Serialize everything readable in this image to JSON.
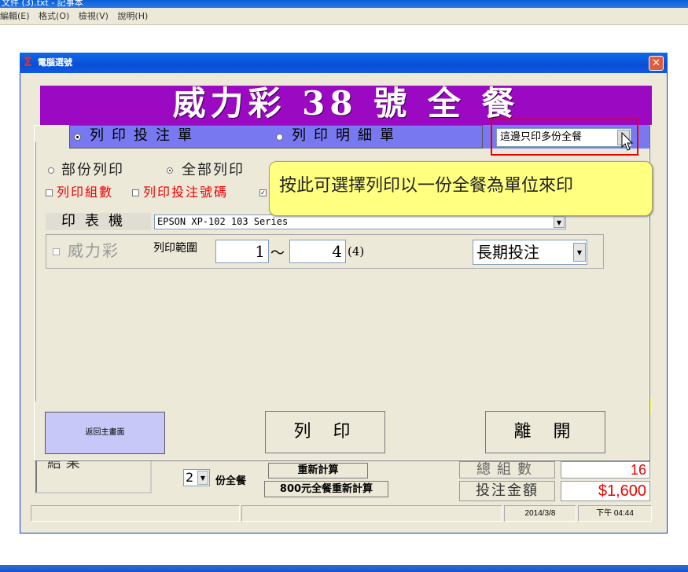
{
  "notepad": {
    "title": "文件 (3).txt - 記事本",
    "menu": [
      "編輯(E)",
      "格式(O)",
      "檢視(V)",
      "說明(H)"
    ]
  },
  "dialog": {
    "title": "電腦選號",
    "banner": "威力彩 38 號 全 餐"
  },
  "print_dialog": {
    "tab_print_ticket": "列印投注單",
    "tab_print_detail": "列印明細單",
    "mode_dropdown": "這邊只印多份全餐",
    "radio_partial": "部份列印",
    "radio_all": "全部列印",
    "chk_group_count": "列印組數",
    "chk_bet_numbers": "列印投注號碼",
    "printer_label": "印表機",
    "printer_value": "EPSON XP-102 103 Series",
    "game_label": "威力彩",
    "range_label": "列印範圍",
    "range_from": "1",
    "range_tilde": "～",
    "range_to": "4",
    "range_count": "(4)",
    "term_value": "長期投注",
    "btn_back": "返回主畫面",
    "btn_print": "列印",
    "btn_leave": "離開"
  },
  "tooltip": "按此可選擇列印以一份全餐為單位來印",
  "background_form": {
    "left_box_text": "結 果",
    "combo_value": "2",
    "fen_label": "份全餐",
    "btn_recalc": "重新計算",
    "btn_recalc800": "800元全餐重新計算",
    "total_label": "總組數",
    "amount_label": "投注金額",
    "total_value": "16",
    "amount_value": "$1,600"
  },
  "status": {
    "date": "2014/3/8",
    "time": "下午 04:44"
  }
}
